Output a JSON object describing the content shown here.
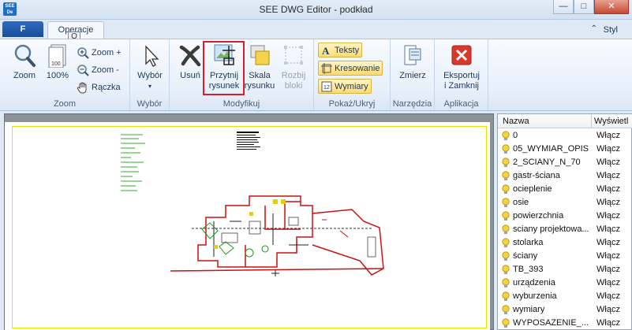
{
  "window": {
    "title": "SEE DWG Editor - podkład",
    "app_icon_text": "SEE\nDe",
    "minimize": "—",
    "maximize": "□",
    "close": "✕"
  },
  "tabs": {
    "file": "F",
    "active": "Operacje",
    "keytip": "O",
    "style_menu": "Styl",
    "style_arrow": "⌃"
  },
  "ribbon": {
    "zoom_group": {
      "label": "Zoom",
      "zoom": "Zoom",
      "percent100": "100%",
      "zoom_in": "Zoom +",
      "zoom_out": "Zoom -",
      "hand": "Rączka"
    },
    "select_group": {
      "label": "Wybór",
      "select": "Wybór"
    },
    "modify_group": {
      "label": "Modyfikuj",
      "delete": "Usuń",
      "crop_line1": "Przytnij",
      "crop_line2": "rysunek",
      "scale_line1": "Skala",
      "scale_line2": "rysunku",
      "explode_line1": "Rozbij",
      "explode_line2": "bloki"
    },
    "show_group": {
      "label": "Pokaż/Ukryj",
      "texts": "Teksty",
      "hatching": "Kresowanie",
      "dimensions": "Wymiary"
    },
    "tools_group": {
      "label": "Narzędzia",
      "measure": "Zmierz"
    },
    "app_group": {
      "label": "Aplikacja",
      "export_line1": "Eksportuj",
      "export_line2": "i Zamknij"
    }
  },
  "layers": {
    "col_name": "Nazwa",
    "col_visible": "Wyświetl",
    "rows": [
      {
        "name": "0",
        "state": "Włącz"
      },
      {
        "name": "05_WYMIAR_OPIS",
        "state": "Włącz"
      },
      {
        "name": "2_SCIANY_N_70",
        "state": "Włącz"
      },
      {
        "name": "gastr-ściana",
        "state": "Włącz"
      },
      {
        "name": "ocieplenie",
        "state": "Włącz"
      },
      {
        "name": "osie",
        "state": "Włącz"
      },
      {
        "name": "powierzchnia",
        "state": "Włącz"
      },
      {
        "name": "sciany projektowa...",
        "state": "Włącz"
      },
      {
        "name": "stolarka",
        "state": "Włącz"
      },
      {
        "name": "ściany",
        "state": "Włącz"
      },
      {
        "name": "TB_393",
        "state": "Włącz"
      },
      {
        "name": "urządzenia",
        "state": "Włącz"
      },
      {
        "name": "wyburzenia",
        "state": "Włącz"
      },
      {
        "name": "wymiary",
        "state": "Włącz"
      },
      {
        "name": "WYPOSAZENIE_...",
        "state": "Włącz"
      }
    ]
  },
  "colors": {
    "highlight": "#d4202a",
    "bulb": "#f7d23a",
    "sheet_border": "#e6e600"
  }
}
